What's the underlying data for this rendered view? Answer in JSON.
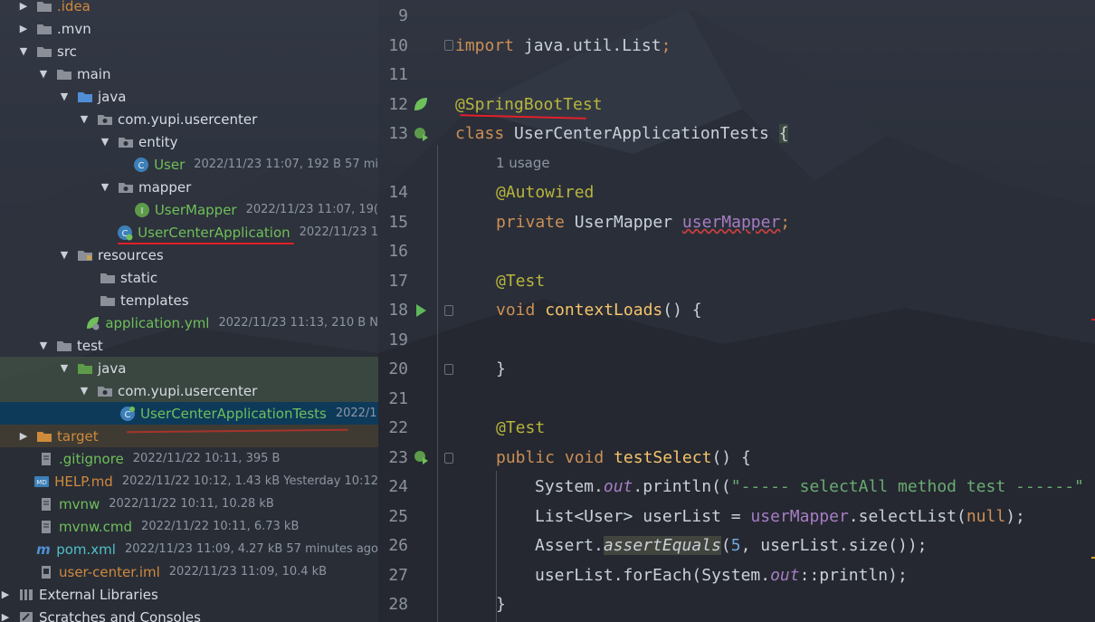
{
  "project_tree": {
    "items": [
      {
        "name": ".idea",
        "meta": ""
      },
      {
        "name": ".mvn",
        "meta": ""
      },
      {
        "name": "src",
        "meta": ""
      },
      {
        "name": "main",
        "meta": ""
      },
      {
        "name": "java",
        "meta": ""
      },
      {
        "name": "com.yupi.usercenter",
        "meta": ""
      },
      {
        "name": "entity",
        "meta": ""
      },
      {
        "name": "User",
        "meta": "2022/11/23 11:07, 192 B 57 mi"
      },
      {
        "name": "mapper",
        "meta": ""
      },
      {
        "name": "UserMapper",
        "meta": "2022/11/23 11:07, 19("
      },
      {
        "name": "UserCenterApplication",
        "meta": "2022/11/23 1"
      },
      {
        "name": "resources",
        "meta": ""
      },
      {
        "name": "static",
        "meta": ""
      },
      {
        "name": "templates",
        "meta": ""
      },
      {
        "name": "application.yml",
        "meta": "2022/11/23 11:13, 210 B N"
      },
      {
        "name": "test",
        "meta": ""
      },
      {
        "name": "java",
        "meta": ""
      },
      {
        "name": "com.yupi.usercenter",
        "meta": ""
      },
      {
        "name": "UserCenterApplicationTests",
        "meta": "2022/1"
      },
      {
        "name": "target",
        "meta": ""
      },
      {
        "name": ".gitignore",
        "meta": "2022/11/22 10:11, 395 B"
      },
      {
        "name": "HELP.md",
        "meta": "2022/11/22 10:12, 1.43 kB Yesterday 10:12"
      },
      {
        "name": "mvnw",
        "meta": "2022/11/22 10:11, 10.28 kB"
      },
      {
        "name": "mvnw.cmd",
        "meta": "2022/11/22 10:11, 6.73 kB"
      },
      {
        "name": "pom.xml",
        "meta": "2022/11/23 11:09, 4.27 kB 57 minutes ago"
      },
      {
        "name": "user-center.iml",
        "meta": "2022/11/23 11:09, 10.4 kB"
      },
      {
        "name": "External Libraries",
        "meta": ""
      },
      {
        "name": "Scratches and Consoles",
        "meta": ""
      }
    ]
  },
  "editor": {
    "line_numbers": [
      "9",
      "10",
      "11",
      "12",
      "13",
      "",
      "14",
      "15",
      "16",
      "17",
      "18",
      "19",
      "20",
      "21",
      "22",
      "23",
      "24",
      "25",
      "26",
      "27",
      "28"
    ],
    "usage_hint": "1 usage",
    "tokens": {
      "import": "import",
      "java_util_list": "java.util.List",
      "semi": ";",
      "springboottest": "@SpringBootTest",
      "class": "class",
      "class_name": "UserCenterApplicationTests",
      "open_brace": "{",
      "autowired": "@Autowired",
      "private": "private",
      "usermapper_type": "UserMapper",
      "usermapper_field": "userMapper",
      "test_ann": "@Test",
      "void": "void",
      "contextloads": "contextLoads",
      "parens": "()",
      "close_brace": "}",
      "public": "public",
      "testselect": "testSelect",
      "system": "System.",
      "out": "out",
      "println_open": ".println((",
      "str_select": "\"----- selectAll method test ------\"",
      "list_user": "List<User> userList = ",
      "selectlist": ".selectList(",
      "null": "null",
      "close_paren_semi": ");",
      "assert": "Assert.",
      "assertequals": "assertEquals",
      "open_paren": "(",
      "five": "5",
      "userlist_size": ", userList.size());",
      "foreach": "userList.forEach(System.",
      "println_ref": "::println);"
    }
  }
}
